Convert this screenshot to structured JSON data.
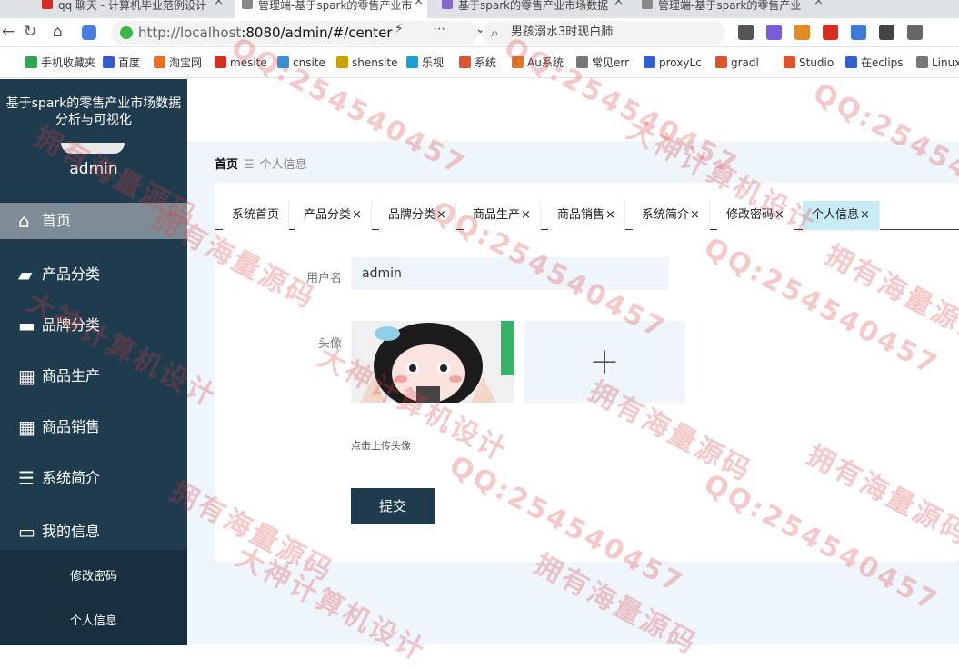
{
  "browser": {
    "tabs": [
      {
        "title": "qq 聊天 - 计算机毕业范例设计",
        "active": false,
        "icon_color": "#d62d20"
      },
      {
        "title": "管理端-基于spark的零售产业市",
        "active": true,
        "icon_color": "#888888"
      },
      {
        "title": "基于spark的零售产业市场数据",
        "active": false,
        "icon_color": "#8a63d2"
      },
      {
        "title": "管理端-基于spark的零售产业",
        "active": false,
        "icon_color": "#888888"
      }
    ],
    "url_host": "http://localhost",
    "url_rest": ":8080/admin/#/center",
    "search_text": "男孩溺水3时现白肺",
    "bookmarks": [
      "手机收藏夹",
      "百度",
      "淘宝网",
      "mesite",
      "cnsite",
      "shensite",
      "乐视",
      "系统",
      "Au系统",
      "常见err",
      "proxyLc",
      "gradl",
      "Studio",
      "在eclips",
      "Linux"
    ],
    "bookmark_colors": [
      "#2fa84f",
      "#2f5fd0",
      "#f26d21",
      "#d62d20",
      "#3a8fd8",
      "#c8a200",
      "#1a9fd8",
      "#e0522b",
      "#e07a20",
      "#777777",
      "#2f5fd0",
      "#e0522b",
      "#e0522b",
      "#2f5fd0",
      "#777777"
    ]
  },
  "sidebar": {
    "brand": "基于spark的零售产业市场数据分析与可视化",
    "username": "admin",
    "menu": [
      {
        "label": "首页",
        "icon": "home-icon",
        "active": true
      },
      {
        "label": "产品分类",
        "icon": "briefcase-icon",
        "active": false
      },
      {
        "label": "品牌分类",
        "icon": "chat-icon",
        "active": false
      },
      {
        "label": "商品生产",
        "icon": "grid-icon",
        "active": false
      },
      {
        "label": "商品销售",
        "icon": "grid-icon",
        "active": false
      },
      {
        "label": "系统简介",
        "icon": "sliders-icon",
        "active": false
      },
      {
        "label": "我的信息",
        "icon": "id-card-icon",
        "active": false
      }
    ],
    "submenu": [
      "修改密码",
      "个人信息"
    ]
  },
  "main": {
    "breadcrumb": {
      "home": "首页",
      "current": "个人信息"
    },
    "tabs": [
      {
        "label": "系统首页",
        "closable": false,
        "active": false
      },
      {
        "label": "产品分类",
        "closable": true,
        "active": false
      },
      {
        "label": "品牌分类",
        "closable": true,
        "active": false
      },
      {
        "label": "商品生产",
        "closable": true,
        "active": false
      },
      {
        "label": "商品销售",
        "closable": true,
        "active": false
      },
      {
        "label": "系统简介",
        "closable": true,
        "active": false
      },
      {
        "label": "修改密码",
        "closable": true,
        "active": false
      },
      {
        "label": "个人信息",
        "closable": true,
        "active": true
      }
    ],
    "form": {
      "username_label": "用户名",
      "username_value": "admin",
      "avatar_label": "头像",
      "upload_hint": "点击上传头像",
      "submit_label": "提交"
    }
  },
  "watermark": [
    "QQ:254540457",
    "拥有海量源码",
    "大神计算机设计"
  ],
  "colors": {
    "sidebar": "#1e3c4e",
    "accent_tab": "#c8ecf5",
    "main_bg": "#eef6fc"
  }
}
